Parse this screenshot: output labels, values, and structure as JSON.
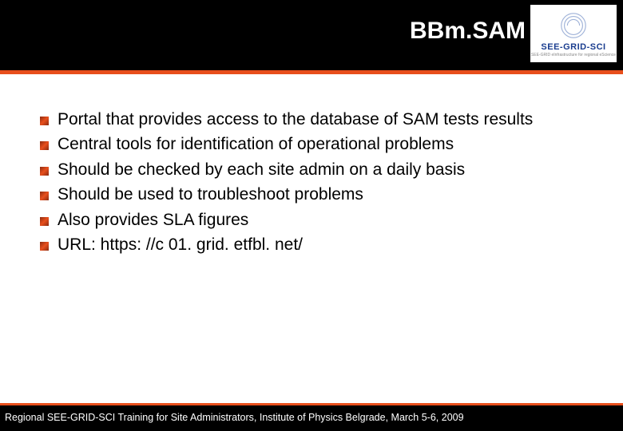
{
  "header": {
    "title": "BBm.SAM",
    "logo_text": "SEE-GRID-SCI",
    "logo_sub": "SEE-GRID eInfrastructure for regional eScience"
  },
  "bullets": [
    "Portal that provides access to the database of SAM tests results",
    "Central tools for identification of operational problems",
    "Should be checked by each site admin on a daily basis",
    "Should be used to troubleshoot problems",
    "Also provides SLA figures",
    "URL: https: //c 01. grid. etfbl. net/"
  ],
  "footer": {
    "text": "Regional SEE-GRID-SCI Training for Site Administrators, Institute of Physics Belgrade, March 5-6, 2009"
  }
}
